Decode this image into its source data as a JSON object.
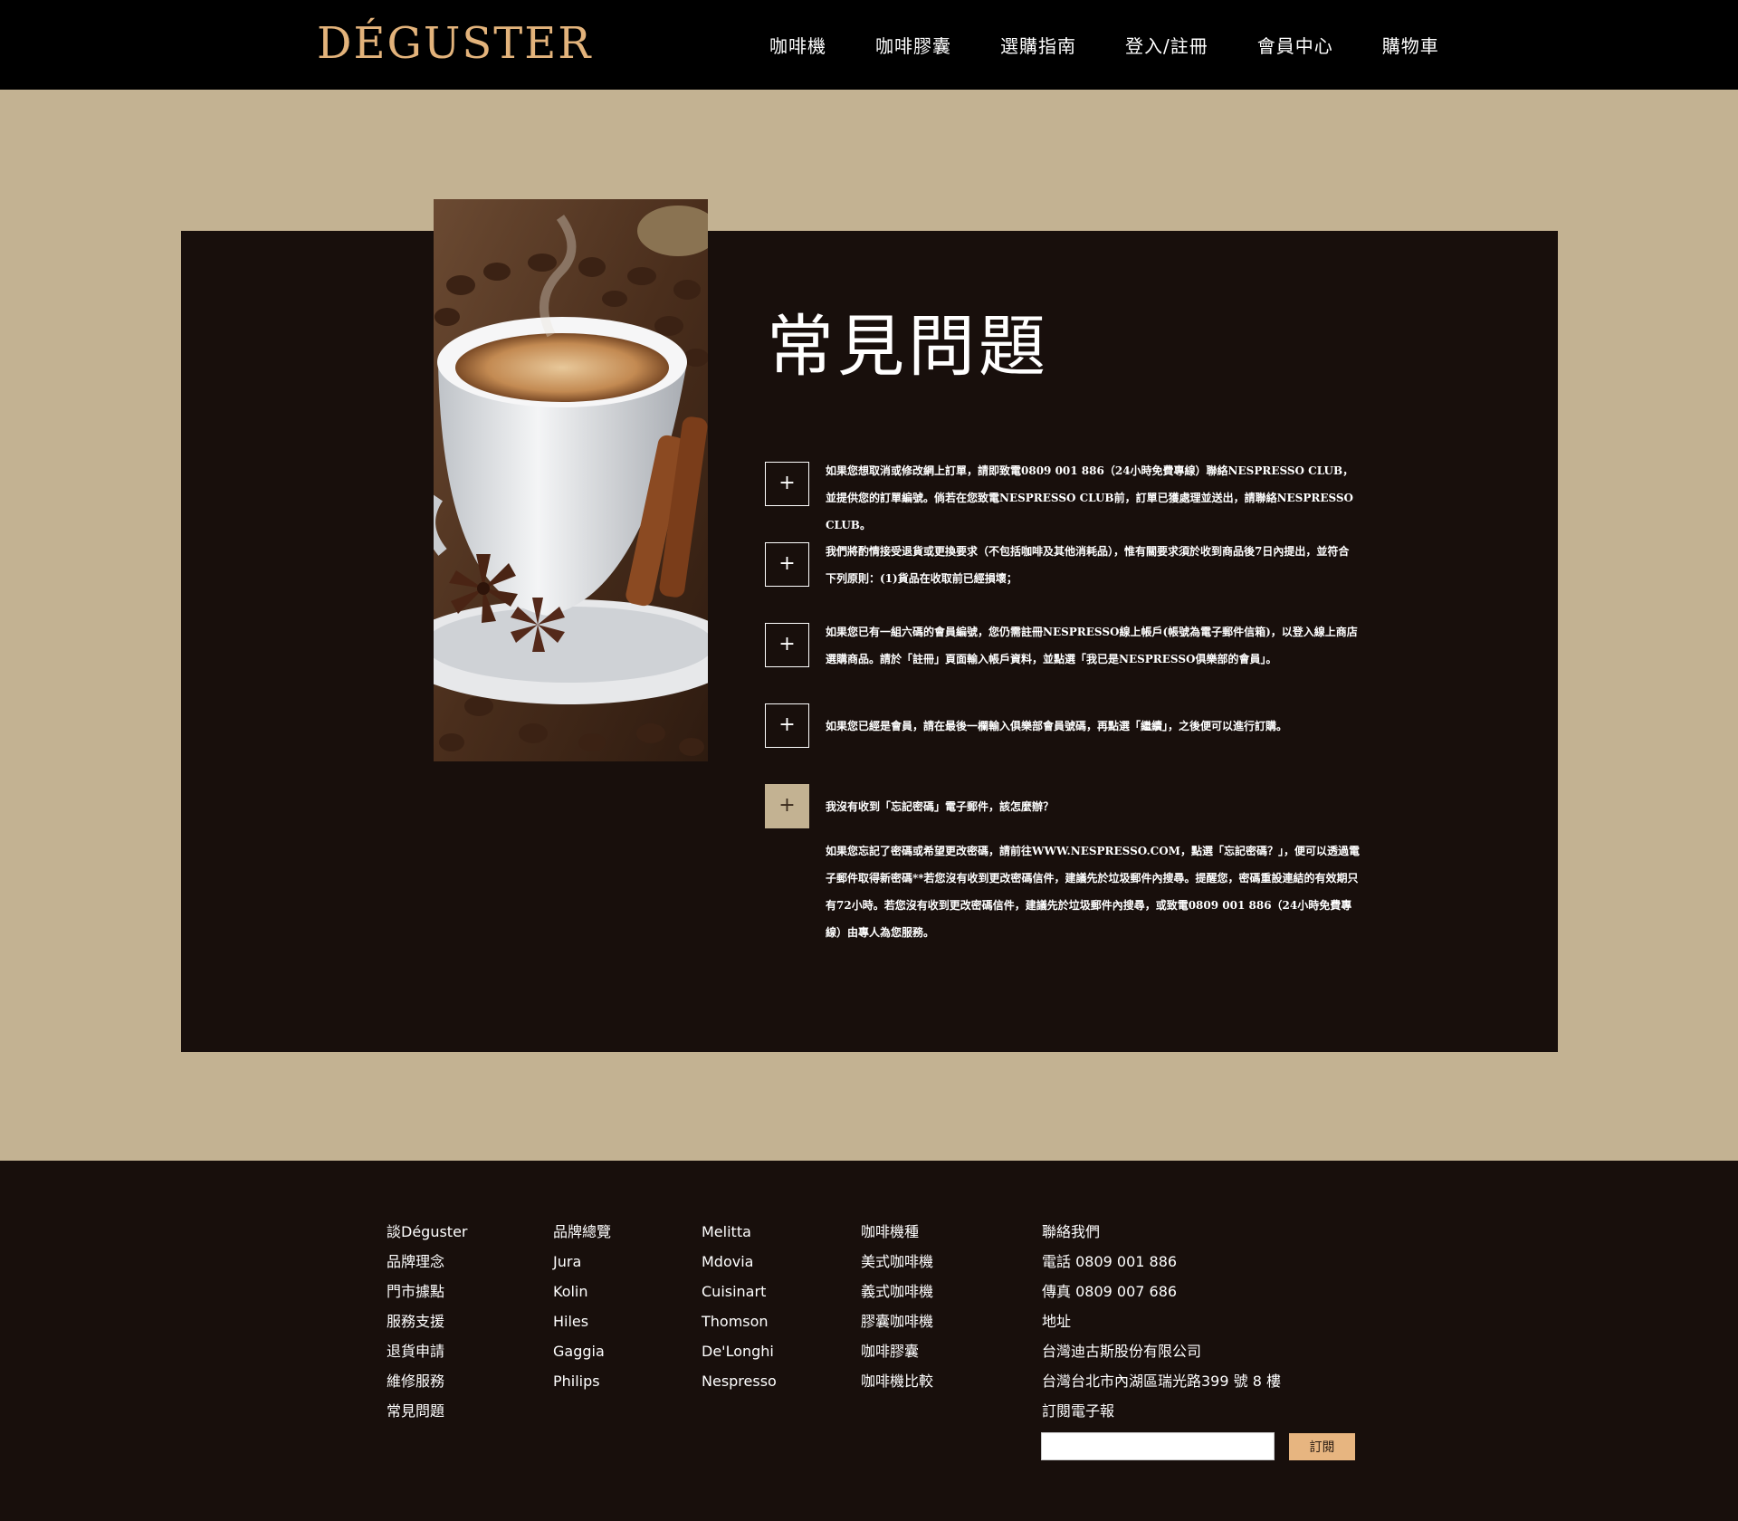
{
  "header": {
    "logo": "DÉGUSTER",
    "nav": [
      "咖啡機",
      "咖啡膠囊",
      "選購指南",
      "登入/註冊",
      "會員中心",
      "購物車"
    ]
  },
  "main": {
    "title": "常見問題",
    "faq": [
      {
        "toggle": "+",
        "question": "如果您想取消或修改網上訂單，請即致電0809 001 886（24小時免費專線）聯絡NESPRESSO CLUB，並提供您的訂單編號。倘若在您致電NESPRESSO CLUB前，訂單已獲處理並送出，請聯絡NESPRESSO CLUB。"
      },
      {
        "toggle": "+",
        "question": "我們將酌情接受退貨或更換要求（不包括咖啡及其他消耗品），惟有關要求須於收到商品後7日內提出，並符合下列原則：(1)貨品在收取前已經損壞；"
      },
      {
        "toggle": "+",
        "question": "如果您已有一組六碼的會員編號，您仍需註冊NESPRESSO線上帳戶(帳號為電子郵件信箱)，以登入線上商店選購商品。請於「註冊」頁面輸入帳戶資料，並點選「我已是NESPRESSO俱樂部的會員」。"
      },
      {
        "toggle": "+",
        "question": "如果您已經是會員，請在最後一欄輸入俱樂部會員號碼，再點選「繼續」，之後便可以進行訂購。"
      },
      {
        "toggle": "+",
        "question": "我沒有收到「忘記密碼」電子郵件，該怎麼辦？",
        "answer": "如果您忘記了密碼或希望更改密碼，請前往WWW.NESPRESSO.COM，點選「忘記密碼？」，便可以透過電子郵件取得新密碼**若您沒有收到更改密碼信件，建議先於垃圾郵件內搜尋。提醒您，密碼重設連結的有效期只有72小時。若您沒有收到更改密碼信件，建議先於垃圾郵件內搜尋，或致電0809 001 886（24小時免費專線）由專人為您服務。"
      }
    ]
  },
  "footer": {
    "about": [
      "談Déguster",
      "品牌理念",
      "門市據點",
      "服務支援",
      "退貨申請",
      "維修服務",
      "常見問題"
    ],
    "brands1": [
      "品牌總覽",
      "Jura",
      "Kolin",
      "Hiles",
      "Gaggia",
      "Philips"
    ],
    "brands2": [
      "Melitta",
      "Mdovia",
      "Cuisinart",
      "Thomson",
      "De'Longhi",
      "Nespresso"
    ],
    "types": [
      "咖啡機種",
      "美式咖啡機",
      "義式咖啡機",
      "膠囊咖啡機",
      "咖啡膠囊",
      "咖啡機比較"
    ],
    "contact": {
      "title": "聯絡我們",
      "phone_label": "電話",
      "phone": "0809 001 886",
      "fax_label": "傳真",
      "fax": "0809 007 686",
      "address_label": "地址",
      "company": "台灣迪古斯股份有限公司",
      "address": "台灣台北市內湖區瑞光路399 號 8 樓",
      "newsletter": "訂閱電子報",
      "subscribe": "訂閱"
    }
  }
}
